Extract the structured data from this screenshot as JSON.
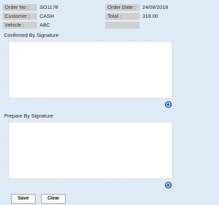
{
  "info": {
    "order_no_label": "Order No :",
    "order_no_value": "SO1178",
    "customer_label": "Customer :",
    "customer_value": "CASH",
    "vehicle_label": "Vehicle :",
    "vehicle_value": "ABC",
    "order_date_label": "Order Date :",
    "order_date_value": "24/08/2018",
    "total_label": "Total :",
    "total_value": "318.00"
  },
  "signatures": {
    "confirmed_label": "Confirmed By Signature",
    "prepare_label": "Prepare By Signature"
  },
  "icons": {
    "refresh": "refresh-icon",
    "accent": "#2f64b7"
  },
  "buttons": {
    "save_label": "Save",
    "clear_label": "Clear"
  }
}
